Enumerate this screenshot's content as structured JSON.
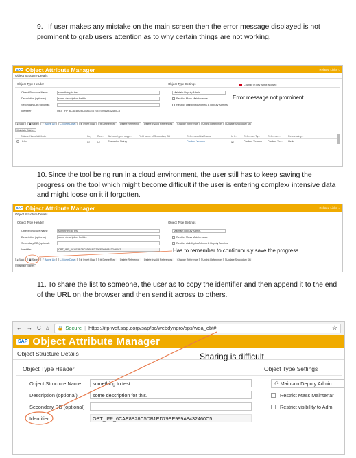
{
  "para9": {
    "num": "9.",
    "text": "If user makes any mistake on the main screen then the error message displayed is not prominent to grab users attention as to why certain things are not working."
  },
  "para10": {
    "num": "10.",
    "text": "Since the tool being run in a cloud environment, the user still has to keep saving the progress on the tool which might become difficult if the user is entering complex/ intensive data and might loose on it if forgotten."
  },
  "para11": {
    "num": "11.",
    "text": "To share the list to someone, the user as to copy the identifier and then append it to the end of the URL on the browser and then send it across to others."
  },
  "app": {
    "sap_logo": "SAP",
    "title": "Object Attribute Manager",
    "related_links": "Related Links ⌵",
    "section": "Object Structure Details",
    "header_title": "Object Type Header",
    "settings_title": "Object Type Settings"
  },
  "form": {
    "structure_name_label": "Object Structure Name",
    "structure_name_value": "something to test",
    "description_label": "Description (optional)",
    "description_value": "some description for this.",
    "secondary_db_label": "Secondary DB (optional)",
    "identifier_label": "Identifier",
    "identifier_value": "OBT_IFP_6CAE8B28C5DB1ED79EE999A8432460C5"
  },
  "settings": {
    "maintain_deputy": "Maintain Deputy Admin.",
    "restrict_mass": "Restrict Mass Maintenance",
    "restrict_visibility": "Restrict visibility to Admins & Deputy Admins",
    "change_notice": "Change in key is not allowed",
    "maintain_deputy_big": "Maintain Deputy Admin.",
    "restrict_mass_big": "Restrict Mass Maintenar",
    "restrict_visibility_big": "Restrict visibility to Admi"
  },
  "toolbar": {
    "back": "Back",
    "save": "Save",
    "move_up": "Move Up",
    "move_down": "Move Down",
    "insert_row": "Insert Row",
    "delete_row": "Delete Row",
    "delete_reference": "Delete Reference",
    "delete_invalid": "Delete Invalid References",
    "change_reference": "Change Reference",
    "unlink_reference": "Unlink Reference",
    "update_secondary": "Update Secondary DB",
    "maintain_entries": "Maintain Entries"
  },
  "table": {
    "headers": [
      "Column Name/Attribute",
      "Key",
      "Req...",
      "Attribute types supp...",
      "Field name of Secondary DB",
      "Referenced List Name",
      "Is K...",
      "Reference Ty...",
      "Reference...",
      "Referencing..."
    ],
    "row": [
      "Hello",
      "☑",
      "☐",
      "Character String",
      "",
      "Product Version",
      "☑",
      "Product Version",
      "Product Ver...",
      "Hello"
    ]
  },
  "annotations": {
    "error_msg": "Error message not prominent",
    "save_reminder": "Has to remember to continuously save the progress.",
    "sharing": "Sharing is difficult"
  },
  "browser": {
    "back": "←",
    "forward": "→",
    "reload": "C",
    "home": "⌂",
    "lock": "🔒",
    "secure": "Secure",
    "url": "https://ifp.wdf.sap.corp/sap/bc/webdynpro/sps/wda_obt#",
    "star": "☆"
  },
  "colors": {
    "brand": "#f0ab00",
    "annotation_line": "#e8794a",
    "error_marker": "#d0021b"
  }
}
